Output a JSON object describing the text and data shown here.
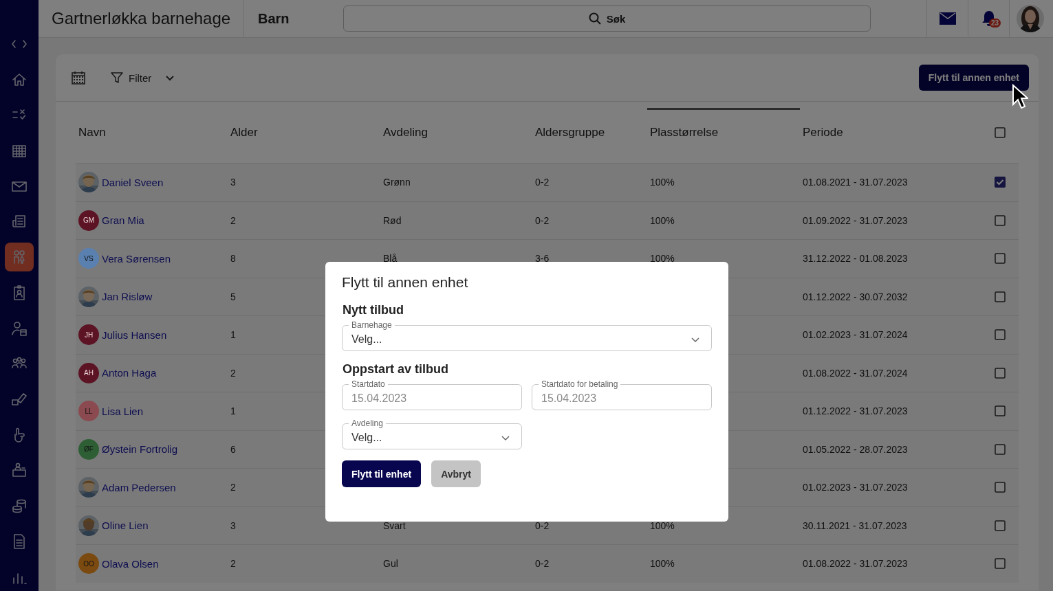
{
  "app": {
    "title": "Gartnerløkka barnehage",
    "section": "Barn",
    "search": {
      "placeholder": "Søk"
    },
    "notifications": "23"
  },
  "sidebar": {
    "items": [
      {
        "selected": false
      },
      {
        "selected": false
      },
      {
        "selected": false
      },
      {
        "selected": false
      },
      {
        "selected": false
      },
      {
        "selected": true
      },
      {
        "selected": false
      },
      {
        "selected": false
      },
      {
        "selected": false
      },
      {
        "selected": false
      },
      {
        "selected": false
      },
      {
        "selected": false
      },
      {
        "selected": false
      },
      {
        "selected": false
      },
      {
        "selected": false
      }
    ]
  },
  "toolbar": {
    "filter": "Filter",
    "action": "Flytt til annen enhet"
  },
  "table": {
    "columns": [
      {
        "label": "Navn",
        "sorted": false
      },
      {
        "label": "Alder",
        "sorted": false
      },
      {
        "label": "Avdeling",
        "sorted": false
      },
      {
        "label": "Aldersgruppe",
        "sorted": false
      },
      {
        "label": "Plasstørrelse",
        "sorted": true
      },
      {
        "label": "Periode",
        "sorted": false
      }
    ],
    "select_all": {
      "checked": false
    },
    "rows": [
      {
        "name": "Daniel Sveen",
        "age": "3",
        "department": "Grønn",
        "age_group": "0-2",
        "size": "100%",
        "period": "01.08.2021 - 31.07.2023",
        "checked": true
      },
      {
        "avatar": {
          "kind": "initials",
          "text": "GM",
          "color": "#5c1424"
        },
        "name": "Gran Mia",
        "age": "2",
        "department": "Rød",
        "age_group": "0-2",
        "size": "100%",
        "period": "01.09.2022 - 31.07.2023",
        "checked": false
      },
      {
        "avatar": {
          "kind": "initials",
          "text": "VS",
          "color": "#5a80b0"
        },
        "name": "Vera Sørensen",
        "age": "8",
        "department": "Blå",
        "age_group": "3-6",
        "size": "100%",
        "period": "31.12.2022 - 01.08.2023",
        "checked": false
      },
      {
        "name": "Jan Risløw",
        "age": "5",
        "period": "01.12.2022 - 30.07.2032",
        "checked": false
      },
      {
        "avatar": {
          "kind": "initials",
          "text": "JH",
          "color": "#5c1424"
        },
        "name": "Julius Hansen",
        "age": "1",
        "period": "01.02.2023 - 31.07.2024",
        "checked": false
      },
      {
        "avatar": {
          "kind": "initials",
          "text": "AH",
          "color": "#5c1424"
        },
        "name": "Anton Haga",
        "age": "2",
        "period": "01.08.2022 - 31.07.2024",
        "checked": false
      },
      {
        "avatar": {
          "kind": "initials",
          "text": "LL",
          "color": "#8a4a50"
        },
        "name": "Lisa Lien",
        "age": "1",
        "period": "01.12.2022 - 31.07.2023",
        "checked": false
      },
      {
        "avatar": {
          "kind": "initials",
          "text": "ØF",
          "color": "#2e5e34"
        },
        "name": "Øystein Fortrolig",
        "age": "6",
        "period": "01.05.2022 - 28.07.2023",
        "checked": false
      },
      {
        "name": "Adam Pedersen",
        "age": "2",
        "period": "01.02.2023 - 31.07.2023",
        "checked": false
      },
      {
        "name": "Oline Lien",
        "age": "3",
        "department": "Svart",
        "age_group": "0-2",
        "size": "100%",
        "period": "30.11.2021 - 31.07.2023",
        "checked": false
      },
      {
        "avatar": {
          "kind": "initials",
          "text": "OO",
          "color": "#7a4a10"
        },
        "name": "Olava Olsen",
        "age": "2",
        "department": "Gul",
        "age_group": "0-2",
        "size": "100%",
        "period": "01.08.2022 - 31.07.2023",
        "checked": false
      }
    ]
  },
  "dialog": {
    "title": "Flytt til annen enhet",
    "sections": [
      {
        "heading": "Nytt tilbud",
        "fields": [
          {
            "kind": "select",
            "label": "Barnehage",
            "value": "Velg...",
            "disabled": false
          }
        ]
      },
      {
        "heading": "Oppstart av tilbud",
        "fields": [
          {
            "kind": "date",
            "label": "Startdato",
            "value": "15.04.2023",
            "disabled": true
          },
          {
            "kind": "date",
            "label": "Startdato for betaling",
            "value": "15.04.2023",
            "disabled": true
          },
          {
            "kind": "select",
            "label": "Avdeling",
            "value": "Velg...",
            "disabled": false
          }
        ]
      }
    ],
    "buttons": [
      {
        "label": "Flytt til enhet",
        "kind": "primary"
      },
      {
        "label": "Avbryt",
        "kind": "secondary"
      }
    ]
  }
}
